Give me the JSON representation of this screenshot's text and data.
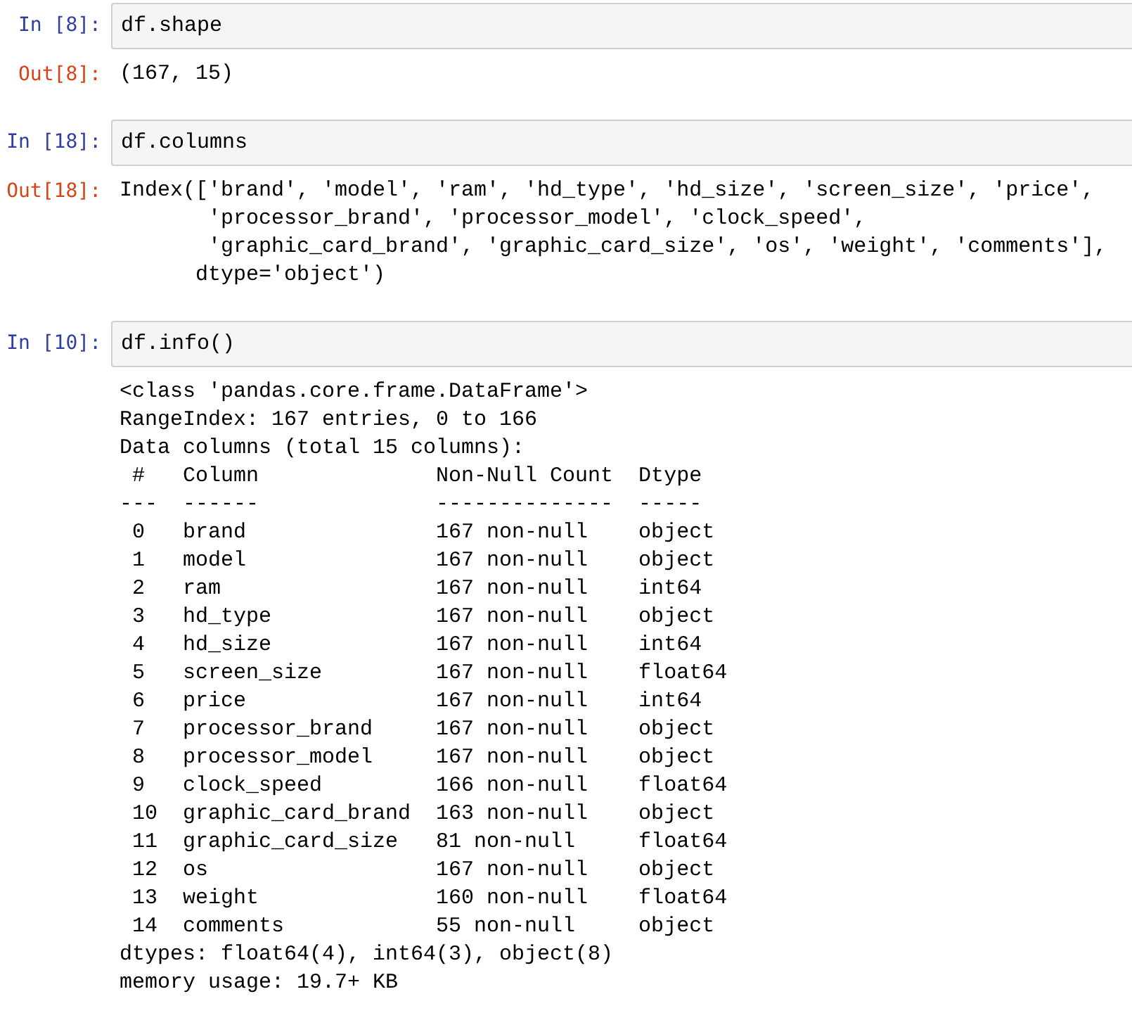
{
  "cells": [
    {
      "in_prompt": "In [8]:",
      "code": "df.shape",
      "out_prompt": "Out[8]:",
      "output": [
        "(167, 15)"
      ]
    },
    {
      "in_prompt": "In [18]:",
      "code": "df.columns",
      "out_prompt": "Out[18]:",
      "output": [
        "Index(['brand', 'model', 'ram', 'hd_type', 'hd_size', 'screen_size', 'price',",
        "       'processor_brand', 'processor_model', 'clock_speed',",
        "       'graphic_card_brand', 'graphic_card_size', 'os', 'weight', 'comments'],",
        "      dtype='object')"
      ]
    },
    {
      "in_prompt": "In [10]:",
      "code": "df.info()",
      "output": [
        "<class 'pandas.core.frame.DataFrame'>",
        "RangeIndex: 167 entries, 0 to 166",
        "Data columns (total 15 columns):",
        " #   Column              Non-Null Count  Dtype  ",
        "---  ------              --------------  -----  ",
        " 0   brand               167 non-null    object ",
        " 1   model               167 non-null    object ",
        " 2   ram                 167 non-null    int64  ",
        " 3   hd_type             167 non-null    object ",
        " 4   hd_size             167 non-null    int64  ",
        " 5   screen_size         167 non-null    float64",
        " 6   price               167 non-null    int64  ",
        " 7   processor_brand     167 non-null    object ",
        " 8   processor_model     167 non-null    object ",
        " 9   clock_speed         166 non-null    float64",
        " 10  graphic_card_brand  163 non-null    object ",
        " 11  graphic_card_size   81 non-null     float64",
        " 12  os                  167 non-null    object ",
        " 13  weight              160 non-null    float64",
        " 14  comments            55 non-null     object ",
        "dtypes: float64(4), int64(3), object(8)",
        "memory usage: 19.7+ KB"
      ]
    }
  ]
}
